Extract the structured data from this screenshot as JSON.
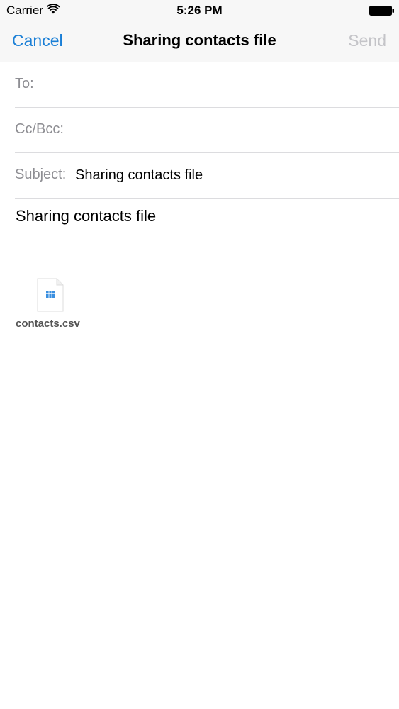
{
  "status_bar": {
    "carrier": "Carrier",
    "time": "5:26 PM",
    "wifi_icon": "wifi-icon",
    "battery_icon": "battery-icon"
  },
  "nav": {
    "cancel_label": "Cancel",
    "title": "Sharing contacts file",
    "send_label": "Send",
    "accent_color": "#1a7fd6",
    "disabled_color": "#c4c4c8"
  },
  "fields": {
    "to_label": "To:",
    "to_value": "",
    "cc_label": "Cc/Bcc:",
    "cc_value": "",
    "subject_label": "Subject:",
    "subject_value": "Sharing contacts file"
  },
  "body": {
    "text": "Sharing contacts file",
    "attachment": {
      "file_name": "contacts.csv",
      "icon": "spreadsheet-file-icon"
    }
  }
}
